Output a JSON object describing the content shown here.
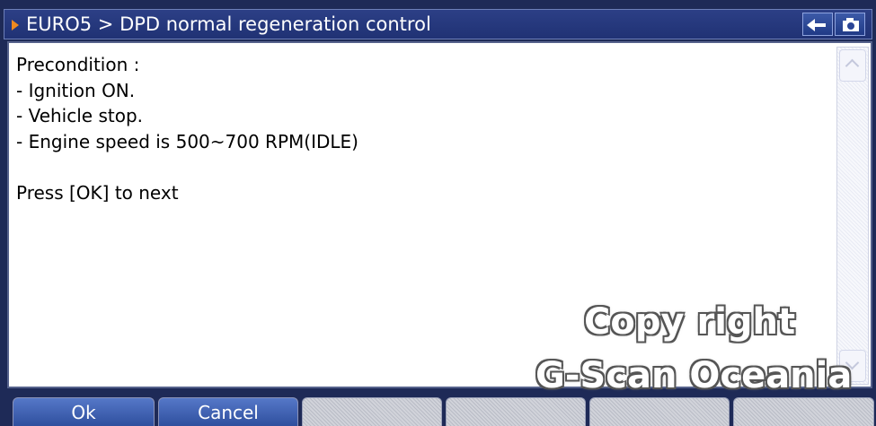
{
  "titlebar": {
    "title": "EURO5 > DPD normal regeneration control",
    "icons": [
      "play-arrow-icon",
      "back-arrow-icon",
      "camera-icon"
    ]
  },
  "content": {
    "lines": [
      "Precondition :",
      "- Ignition ON.",
      "- Vehicle stop.",
      "- Engine speed is 500~700 RPM(IDLE)",
      "",
      "Press [OK] to next"
    ]
  },
  "watermark": {
    "line1": "Copy right",
    "line2": "G-Scan Oceania"
  },
  "buttons": {
    "ok": "Ok",
    "cancel": "Cancel"
  },
  "colors": {
    "background": "#1e2a57",
    "title_arrow": "#f08a1e",
    "active_button": "#3f62b4"
  }
}
